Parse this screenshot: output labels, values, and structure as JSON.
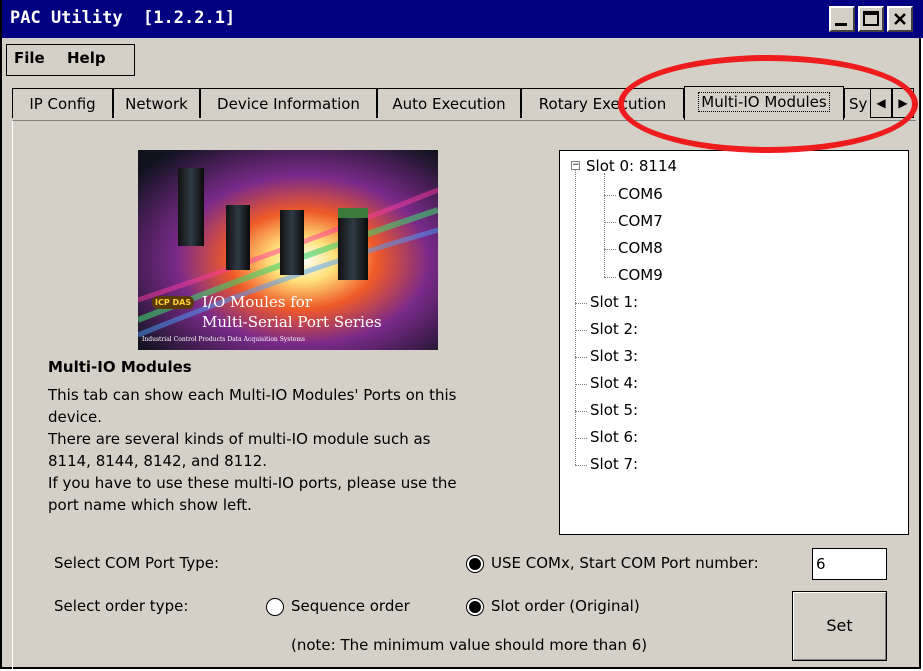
{
  "window": {
    "title": "PAC Utility  [1.2.2.1]"
  },
  "menubar": {
    "items": [
      "File",
      "Help"
    ]
  },
  "tabs": [
    {
      "label": "IP Config"
    },
    {
      "label": "Network"
    },
    {
      "label": "Device Information"
    },
    {
      "label": "Auto Execution"
    },
    {
      "label": "Rotary Execution"
    },
    {
      "label": "Multi-IO Modules"
    },
    {
      "label": "Sy"
    }
  ],
  "banner": {
    "line1": "I/O Moules for",
    "line2": "Multi-Serial Port Series",
    "line3": "Industrial Control Products Data Acquisition Systems",
    "logo": "ICP DAS"
  },
  "description": {
    "title": "Multi-IO Modules",
    "lines": [
      "This tab can show each Multi-IO Modules' Ports on this",
      "device.",
      "There are several kinds of multi-IO module such as",
      "8114, 8144, 8142, and 8112.",
      "If you have to use these multi-IO ports, please use the",
      "port name which show left."
    ]
  },
  "tree": {
    "root": {
      "label": "Slot 0: 8114",
      "children": [
        "COM6",
        "COM7",
        "COM8",
        "COM9"
      ]
    },
    "slots": [
      "Slot 1:",
      "Slot 2:",
      "Slot 3:",
      "Slot 4:",
      "Slot 5:",
      "Slot 6:",
      "Slot 7:"
    ]
  },
  "settings": {
    "com_type_label": "Select COM Port Type:",
    "use_comx_label": "USE COMx, Start COM Port number:",
    "start_com_value": "6",
    "order_type_label": "Select order type:",
    "sequence_label": "Sequence order",
    "slot_order_label": "Slot order (Original)",
    "note": "(note: The minimum value should more than 6)",
    "set_label": "Set"
  },
  "colors": {
    "titlebar": "#000080",
    "annotation": "#ee1c1c",
    "window_bg": "#d4d0c8"
  }
}
